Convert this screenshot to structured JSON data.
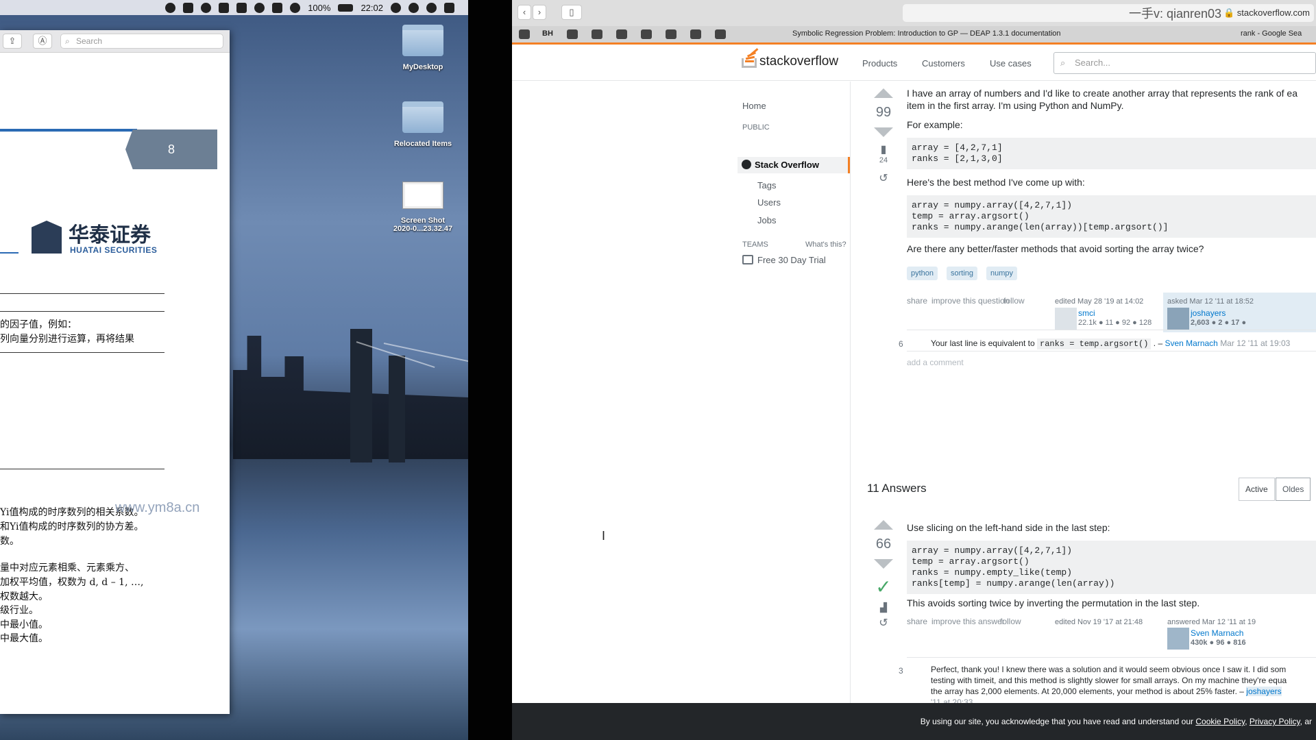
{
  "menubar": {
    "battery": "100%",
    "time": "22:02"
  },
  "desktop": {
    "icons": [
      {
        "label": "MyDesktop"
      },
      {
        "label": "Relocated Items"
      },
      {
        "label_line1": "Screen Shot",
        "label_line2": "2020-0...23.32.47"
      }
    ]
  },
  "pdf_viewer": {
    "search_placeholder": "Search",
    "page_badge": "8",
    "logo_cn": "华泰证券",
    "logo_en": "HUATAI SECURITIES",
    "lines": [
      "的因子值，例如：",
      "列向量分别进行运算，再将结果",
      "Yi值构成的时序数列的相关系数。",
      "和Yi值构成的时序数列的协方差。",
      "数。",
      "量中对应元素相乘、元素乘方、",
      "加权平均值，权数为 d, d – 1, …,",
      "权数越大。",
      "级行业。",
      "中最小值。",
      "中最大值。"
    ],
    "watermark": "www.ym8a.cn"
  },
  "browser": {
    "url": "stackoverflow.com",
    "watermark": "一手v: qianren03",
    "active_tab": "Symbolic Regression Problem: Introduction to GP — DEAP 1.3.1 documentation",
    "right_tab": "rank - Google Sea",
    "bookmark_bh": "BH"
  },
  "so": {
    "logo": "stackoverflow",
    "nav": {
      "products": "Products",
      "customers": "Customers",
      "use_cases": "Use cases"
    },
    "search_placeholder": "Search...",
    "sidebar": {
      "home": "Home",
      "public": "PUBLIC",
      "stack_overflow": "Stack Overflow",
      "tags": "Tags",
      "users": "Users",
      "jobs": "Jobs",
      "teams": "TEAMS",
      "whats_this": "What's this?",
      "free_trial": "Free 30 Day Trial"
    },
    "question": {
      "votes": "99",
      "bookmarks": "24",
      "line1": "I have an array of numbers and I'd like to create another array that represents the rank of ea",
      "line2": "item in the first array. I'm using Python and NumPy.",
      "for_example": "For example:",
      "code1": "array = [4,2,7,1]\nranks = [2,1,3,0]",
      "best_method": "Here's the best method I've come up with:",
      "code2": "array = numpy.array([4,2,7,1])\ntemp = array.argsort()\nranks = numpy.arange(len(array))[temp.argsort()]",
      "ask": "Are there any better/faster methods that avoid sorting the array twice?",
      "tags": [
        "python",
        "sorting",
        "numpy"
      ],
      "share": "share",
      "improve": "improve this question",
      "follow": "follow",
      "edited": "edited May 28 '19 at 14:02",
      "editor": "smci",
      "editor_rep": "22.1k ● 11 ● 92 ● 128",
      "asked": "asked Mar 12 '11 at 18:52",
      "asker": "joshayers",
      "asker_rep": "2,603 ● 2 ● 17 ●"
    },
    "qcomment": {
      "score": "6",
      "text_before": "Your last line is equivalent to",
      "code": "ranks = temp.argsort()",
      "text_after": ". –",
      "user": "Sven Marnach",
      "date": "Mar 12 '11 at 19:03",
      "add_comment": "add a comment"
    },
    "answers_header": "11 Answers",
    "sort": {
      "active": "Active",
      "oldest": "Oldes"
    },
    "answer": {
      "votes": "66",
      "intro": "Use slicing on the left-hand side in the last step:",
      "code": "array = numpy.array([4,2,7,1])\ntemp = array.argsort()\nranks = numpy.empty_like(temp)\nranks[temp] = numpy.arange(len(array))",
      "note": "This avoids sorting twice by inverting the permutation in the last step.",
      "share": "share",
      "improve": "improve this answer",
      "follow": "follow",
      "edited": "edited Nov 19 '17 at 21:48",
      "answered": "answered Mar 12 '11 at 19",
      "author": "Sven Marnach",
      "author_rep": "430k ● 96 ● 816"
    },
    "acomment": {
      "score": "3",
      "line1": "Perfect, thank you! I knew there was a solution and it would seem obvious once I saw it. I did som",
      "line2": "testing with timeit, and this method is slightly slower for small arrays. On my machine they're equa",
      "line3": "the array has 2,000 elements. At 20,000 elements, your method is about 25% faster. –",
      "user": "joshayers",
      "date": "'11 at 20:33"
    },
    "cookie": {
      "text": "By using our site, you acknowledge that you have read and understand our",
      "cookie_policy": "Cookie Policy",
      "privacy_policy": "Privacy Policy",
      "tail": ", ar"
    }
  }
}
